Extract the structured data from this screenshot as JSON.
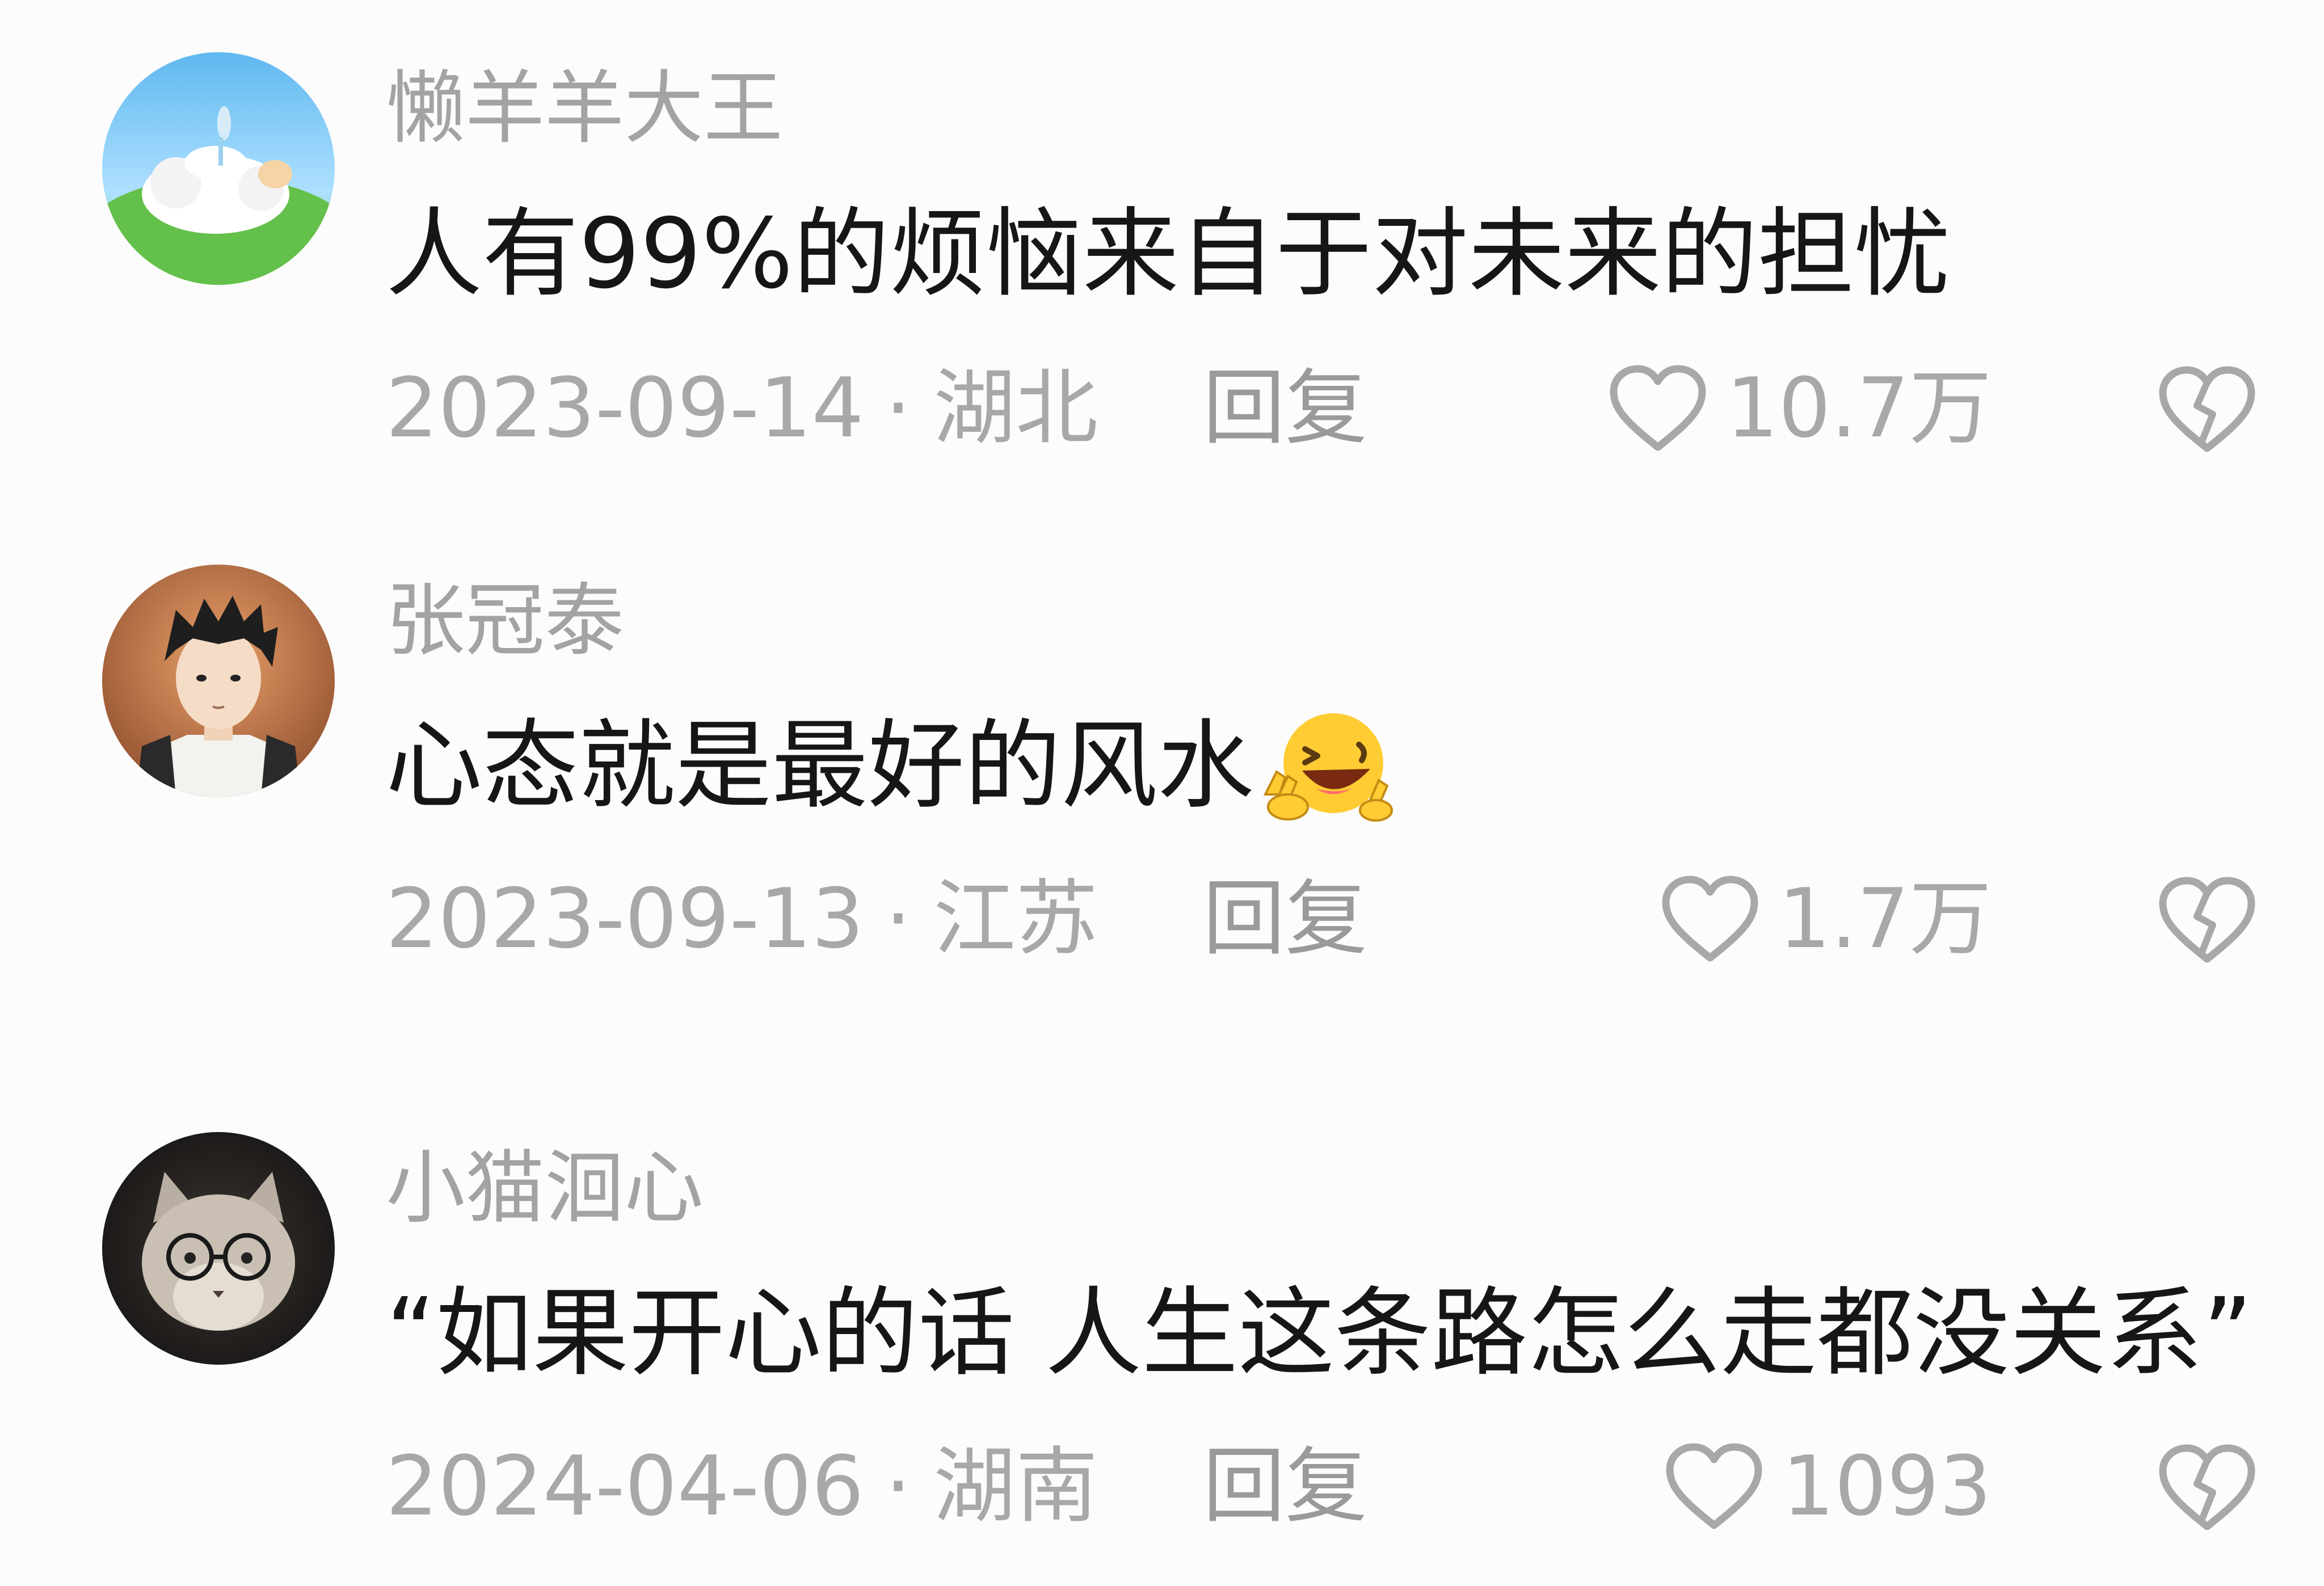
{
  "colors": {
    "background": "#fcfcfc",
    "username": "#a3a3a3",
    "content": "#161616",
    "meta": "#a8a8a8"
  },
  "comments": [
    {
      "username": "懒羊羊大王",
      "content": "人有99%的烦恼来自于对未来的担忧",
      "date": "2023-09-14",
      "separator": "·",
      "location": "湖北",
      "reply_label": "回复",
      "likes": "10.7万",
      "avatar_icon": "sleeping-sheep-avatar"
    },
    {
      "username": "张冠泰",
      "content": "心态就是最好的风水",
      "emoji": "laughing-wink-emoji",
      "date": "2023-09-13",
      "separator": "·",
      "location": "江苏",
      "reply_label": "回复",
      "likes": "1.7万",
      "avatar_icon": "anime-boy-avatar"
    },
    {
      "username": "小猫洄心",
      "content": "“如果开心的话 人生这条路怎么走都没关系”",
      "date": "2024-04-06",
      "separator": "·",
      "location": "湖南",
      "reply_label": "回复",
      "likes": "1093",
      "avatar_icon": "cat-with-glasses-avatar"
    }
  ]
}
